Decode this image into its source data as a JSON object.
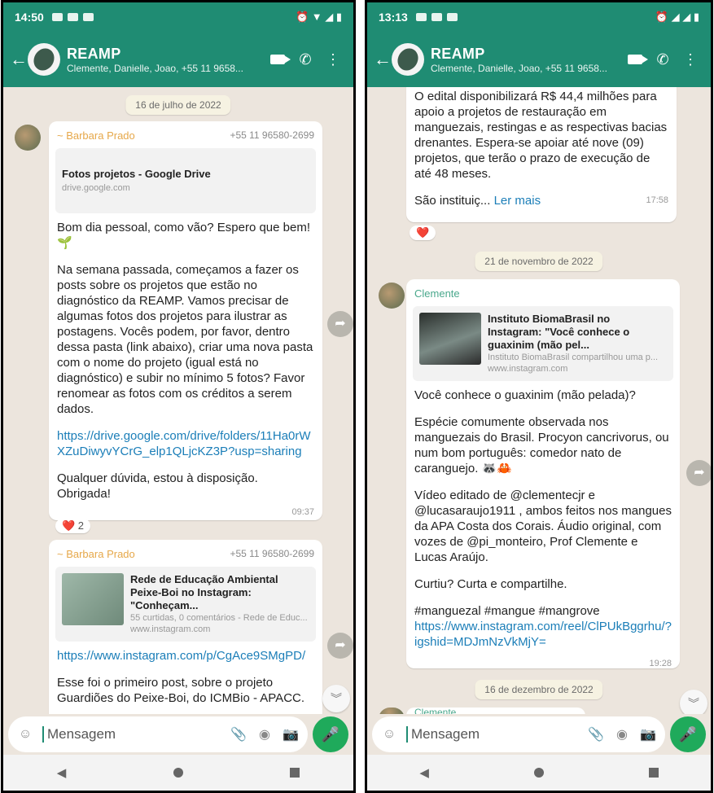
{
  "left": {
    "status": {
      "time": "14:50"
    },
    "header": {
      "title": "REAMP",
      "subtitle": "Clemente, Danielle, Joao, +55 11 9658..."
    },
    "date_chip": "16 de julho de 2022",
    "msg1": {
      "sender": "~ Barbara Prado",
      "phone": "+55 11 96580-2699",
      "preview_title": "Fotos projetos - Google Drive",
      "preview_domain": "drive.google.com",
      "p1": "Bom dia pessoal, como vão? Espero que bem! 🌱",
      "p2": "Na semana passada, começamos a fazer os posts sobre os projetos que estão no diagnóstico da REAMP. Vamos precisar de algumas fotos dos projetos para ilustrar as postagens. Vocês podem, por favor, dentro dessa pasta (link abaixo), criar uma nova pasta com o nome do projeto (igual está no diagnóstico) e subir no mínimo 5 fotos? Favor renomear as fotos com os créditos a serem dados.",
      "link": "https://drive.google.com/drive/folders/11Ha0rWXZuDiwyvYCrG_elp1QLjcKZ3P?usp=sharing",
      "p3": "Qualquer dúvida, estou à disposição. Obrigada!",
      "time": "09:37",
      "reaction": "❤️ 2"
    },
    "msg2": {
      "sender": "~ Barbara Prado",
      "phone": "+55 11 96580-2699",
      "preview_title": "Rede de Educação Ambiental Peixe-Boi no Instagram: \"Conheçam...",
      "preview_desc": "55 curtidas, 0 comentários - Rede de Educ...",
      "preview_domain": "www.instagram.com",
      "link": "https://www.instagram.com/p/CgAce9SMgPD/",
      "p1": "Esse foi o primeiro post, sobre o projeto Guardiões do Peixe-Boi, do ICMBio - APACC."
    },
    "input": {
      "placeholder": "Mensagem"
    }
  },
  "right": {
    "status": {
      "time": "13:13"
    },
    "header": {
      "title": "REAMP",
      "subtitle": "Clemente, Danielle, Joao, +55 11 9658..."
    },
    "msg0": {
      "text": "O edital disponibilizará R$ 44,4 milhões para apoio a projetos de restauração em manguezais, restingas e as respectivas bacias drenantes. Espera-se apoiar até nove (09) projetos, que terão o prazo de execução de até 48 meses.",
      "truncated": "São instituiç...",
      "more": "Ler mais",
      "time": "17:58",
      "reaction": "❤️"
    },
    "date_chip1": "21 de novembro de 2022",
    "msg1": {
      "sender": "Clemente",
      "preview_title": "Instituto BiomaBrasil no Instagram: \"Você conhece o guaxinim (mão pel...",
      "preview_desc": "Instituto BiomaBrasil compartilhou uma p...",
      "preview_domain": "www.instagram.com",
      "p1": "Você conhece o guaxinim (mão pelada)?",
      "p2": "Espécie comumente observada nos manguezais do Brasil. Procyon cancrivorus, ou num bom português: comedor nato de caranguejo. 🦝🦀",
      "p3": "Vídeo editado de @clementecjr e @lucasaraujo1911 , ambos feitos nos mangues da APA Costa dos Corais. Áudio original, com vozes de @pi_monteiro, Prof Clemente e Lucas Araújo.",
      "p4": "Curtiu? Curta e compartilhe.",
      "hashtags": "#manguezal #mangue #mangrove",
      "link": "https://www.instagram.com/reel/ClPUkBggrhu/?igshid=MDJmNzVkMjY=",
      "time": "19:28"
    },
    "date_chip2": "16 de dezembro de 2022",
    "msg2_sender": "Clemente",
    "input": {
      "placeholder": "Mensagem"
    }
  },
  "icons": {
    "back": "arrow-left-icon",
    "video": "video-call-icon",
    "call": "phone-icon",
    "menu": "more-vert-icon"
  }
}
